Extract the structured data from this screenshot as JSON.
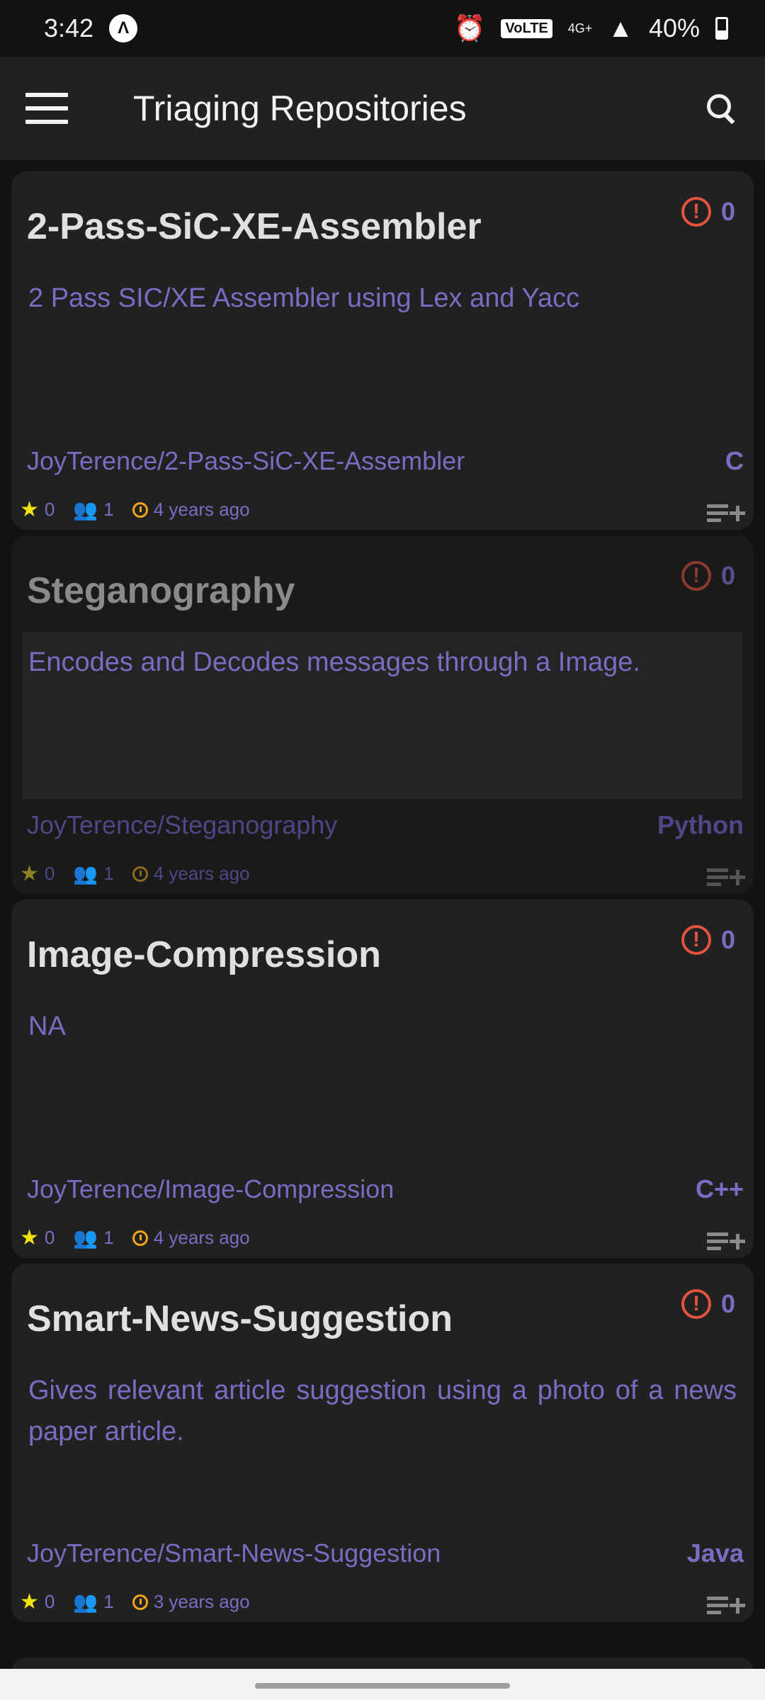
{
  "status_bar": {
    "time": "3:42",
    "notification_letter": "Λ",
    "volte_label": "VoLTE",
    "network_label": "4G+",
    "battery_percent": "40%",
    "battery_level": 0.4
  },
  "app_bar": {
    "title": "Triaging Repositories"
  },
  "repos": [
    {
      "name": "2-Pass-SiC-XE-Assembler",
      "issues": "0",
      "description": "2 Pass SIC/XE Assembler using Lex and Yacc",
      "full_name": "JoyTerence/2-Pass-SiC-XE-Assembler",
      "language": "C",
      "stars": "0",
      "contributors": "1",
      "updated": "4 years ago",
      "dimmed": false
    },
    {
      "name": "Steganography",
      "issues": "0",
      "description": "Encodes and Decodes messages through a Image.",
      "full_name": "JoyTerence/Steganography",
      "language": "Python",
      "stars": "0",
      "contributors": "1",
      "updated": "4 years ago",
      "dimmed": true
    },
    {
      "name": "Image-Compression",
      "issues": "0",
      "description": "NA",
      "full_name": "JoyTerence/Image-Compression",
      "language": "C++",
      "stars": "0",
      "contributors": "1",
      "updated": "4 years ago",
      "dimmed": false
    },
    {
      "name": "Smart-News-Suggestion",
      "issues": "0",
      "description": "Gives relevant article suggestion using a photo of a news paper article.",
      "full_name": "JoyTerence/Smart-News-Suggestion",
      "language": "Java",
      "stars": "0",
      "contributors": "1",
      "updated": "3 years ago",
      "dimmed": false
    }
  ],
  "colors": {
    "background": "#121212",
    "card": "#212121",
    "accent_purple": "#7a6cc2",
    "issue_red": "#e0533f",
    "star_yellow": "#f2e20c",
    "people_green": "#2f9a3c",
    "clock_orange": "#f2a41c"
  },
  "icons": {
    "menu": "menu-icon",
    "search": "search-icon",
    "issue": "alert-circle-icon",
    "star": "star-icon",
    "contributors": "people-icon",
    "updated": "clock-icon",
    "add_to_list": "playlist-add-icon"
  }
}
